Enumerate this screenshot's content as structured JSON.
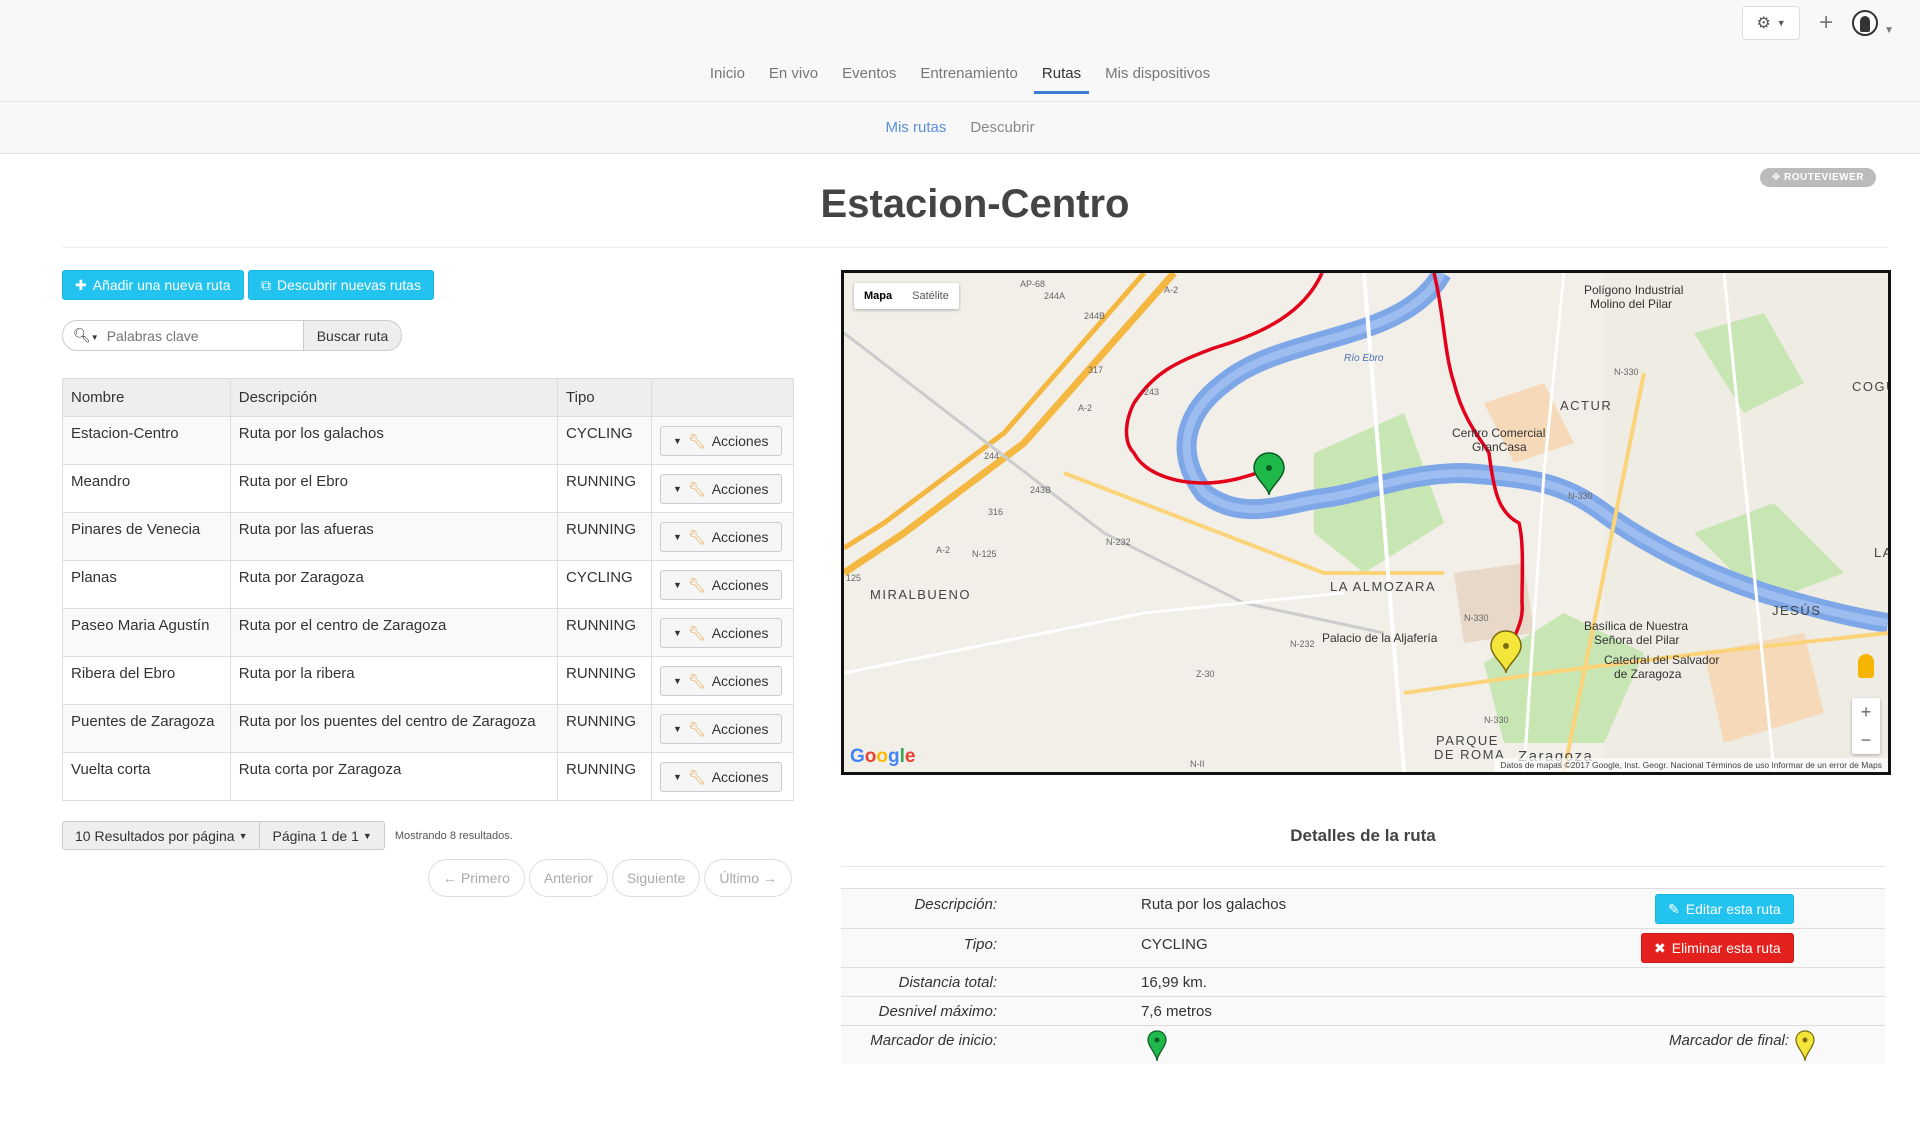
{
  "topbar": {
    "nav": [
      "Inicio",
      "En vivo",
      "Eventos",
      "Entrenamiento",
      "Rutas",
      "Mis dispositivos"
    ],
    "active_nav": "Rutas"
  },
  "subnav": {
    "items": [
      "Mis rutas",
      "Descubrir"
    ],
    "active": "Mis rutas"
  },
  "badge": "ROUTEVIEWER",
  "page_title": "Estacion-Centro",
  "buttons": {
    "add_route": "Añadir una nueva ruta",
    "discover_routes": "Descubrir nuevas rutas"
  },
  "search": {
    "placeholder": "Palabras clave",
    "button": "Buscar ruta"
  },
  "table": {
    "headers": [
      "Nombre",
      "Descripción",
      "Tipo",
      ""
    ],
    "action_label": "Acciones",
    "rows": [
      {
        "name": "Estacion-Centro",
        "description": "Ruta por los galachos",
        "type": "CYCLING"
      },
      {
        "name": "Meandro",
        "description": "Ruta por el Ebro",
        "type": "RUNNING"
      },
      {
        "name": "Pinares de Venecia",
        "description": "Ruta por las afueras",
        "type": "RUNNING"
      },
      {
        "name": "Planas",
        "description": "Ruta por Zaragoza",
        "type": "CYCLING"
      },
      {
        "name": "Paseo Maria Agustín",
        "description": "Ruta por el centro de Zaragoza",
        "type": "RUNNING"
      },
      {
        "name": "Ribera del Ebro",
        "description": "Ruta por la ribera",
        "type": "RUNNING"
      },
      {
        "name": "Puentes de Zaragoza",
        "description": "Ruta por los puentes del centro de Zaragoza",
        "type": "RUNNING"
      },
      {
        "name": "Vuelta corta",
        "description": "Ruta corta por Zaragoza",
        "type": "RUNNING"
      }
    ]
  },
  "pagination": {
    "per_page": "10 Resultados por página",
    "page": "Página 1 de 1",
    "info": "Mostrando 8 resultados.",
    "first": "← Primero",
    "prev": "Anterior",
    "next": "Siguiente",
    "last": "Último →"
  },
  "map": {
    "type_map": "Mapa",
    "type_satellite": "Satélite",
    "labels": {
      "poligono": "Polígono Industrial",
      "molino": "Molino del Pilar",
      "actur": "ACTUR",
      "centro_comercial": "Centro Comercial",
      "grancasa": "GranCasa",
      "la_almozara": "LA ALMOZARA",
      "miralbueno": "MIRALBUENO",
      "jesus": "JESÚS",
      "palacio": "Palacio de la Aljafería",
      "basilica": "Basílica de Nuestra",
      "senora": "Señora del Pilar",
      "catedral": "Catedral del Salvador",
      "de_zaragoza": "de Zaragoza",
      "parque": "PARQUE",
      "de_roma": "DE ROMA",
      "zaragoza": "Zaragoza",
      "rio_ebro": "Río Ebro",
      "cogu": "COGU",
      "la": "LA"
    },
    "roads": [
      "AP-68",
      "A-2",
      "244A",
      "244B",
      "317",
      "243",
      "244",
      "243B",
      "316",
      "A-2",
      "N-125",
      "N-232",
      "N-232",
      "N-330",
      "N-330",
      "Z-30",
      "N-330",
      "N-II",
      "125",
      "A-2",
      "N-330"
    ],
    "attribution": "Datos de mapas ©2017 Google, Inst. Geogr. Nacional   Términos de uso   Informar de un error de Maps",
    "logo": [
      "G",
      "o",
      "o",
      "g",
      "l",
      "e"
    ]
  },
  "details": {
    "title": "Detalles de la ruta",
    "description_label": "Descripción:",
    "description": "Ruta por los galachos",
    "type_label": "Tipo:",
    "type": "CYCLING",
    "distance_label": "Distancia total:",
    "distance": "16,99 km.",
    "elevation_label": "Desnivel máximo:",
    "elevation": "7,6 metros",
    "start_marker_label": "Marcador de inicio:",
    "end_marker_label": "Marcador de final:",
    "edit_button": "Editar esta ruta",
    "delete_button": "Eliminar esta ruta"
  },
  "colors": {
    "accent": "#23c3ef",
    "danger": "#e5211d",
    "route": "#e3001b",
    "river": "#6b9de8",
    "start_marker": "#1fb84a",
    "end_marker": "#f3e53a"
  }
}
